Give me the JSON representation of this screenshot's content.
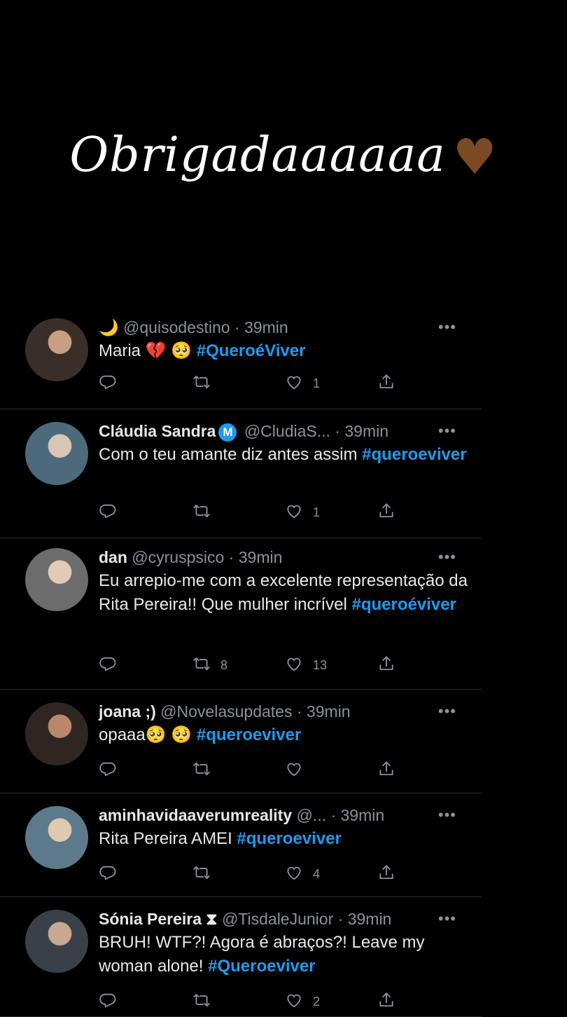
{
  "story": {
    "caption": "Obrigadaaaaaa",
    "emoji": "♥"
  },
  "tweets": [
    {
      "name": "🌙",
      "badge": "",
      "handle": "@quisodestino",
      "sep": " · ",
      "time": "39min",
      "text_parts": [
        {
          "t": "Maria 💔 🥺 ",
          "tag": false
        },
        {
          "t": "#QueroéViver",
          "tag": true
        }
      ],
      "reply": "",
      "retweets": "",
      "likes": "1"
    },
    {
      "name": "Cláudia Sandra",
      "badge": "M",
      "handle": "@CludiaS...",
      "sep": " · ",
      "time": "39min",
      "text_parts": [
        {
          "t": "Com o teu amante diz antes assim ",
          "tag": false
        },
        {
          "t": "#queroeviver",
          "tag": true
        }
      ],
      "reply": "",
      "retweets": "",
      "likes": "1"
    },
    {
      "name": "dan",
      "badge": "",
      "handle": "@cyruspsico",
      "sep": " · ",
      "time": "39min",
      "text_parts": [
        {
          "t": "Eu arrepio-me com a excelente representação da Rita Pereira!! Que mulher incrível ",
          "tag": false
        },
        {
          "t": "#queroéviver",
          "tag": true
        }
      ],
      "reply": "",
      "retweets": "8",
      "likes": "13"
    },
    {
      "name": "joana ;)",
      "badge": "",
      "handle": "@Novelasupdates",
      "sep": " · ",
      "time": "39min",
      "text_parts": [
        {
          "t": "opaaa🥺 🥺 ",
          "tag": false
        },
        {
          "t": "#queroeviver",
          "tag": true
        }
      ],
      "reply": "",
      "retweets": "",
      "likes": ""
    },
    {
      "name": "aminhavidaaverumreality",
      "badge": "",
      "handle": "@...",
      "sep": " · ",
      "time": "39min",
      "text_parts": [
        {
          "t": "Rita Pereira AMEI ",
          "tag": false
        },
        {
          "t": "#queroeviver",
          "tag": true
        }
      ],
      "reply": "",
      "retweets": "",
      "likes": "4"
    },
    {
      "name": "Sónia Pereira ⧗",
      "badge": "",
      "handle": "@TisdaleJunior",
      "sep": " · ",
      "time": "39min",
      "text_parts": [
        {
          "t": "BRUH! WTF?! Agora é abraços?! Leave my woman alone! ",
          "tag": false
        },
        {
          "t": "#Queroeviver",
          "tag": true
        }
      ],
      "reply": "",
      "retweets": "",
      "likes": "2"
    }
  ],
  "more_label": "•••"
}
